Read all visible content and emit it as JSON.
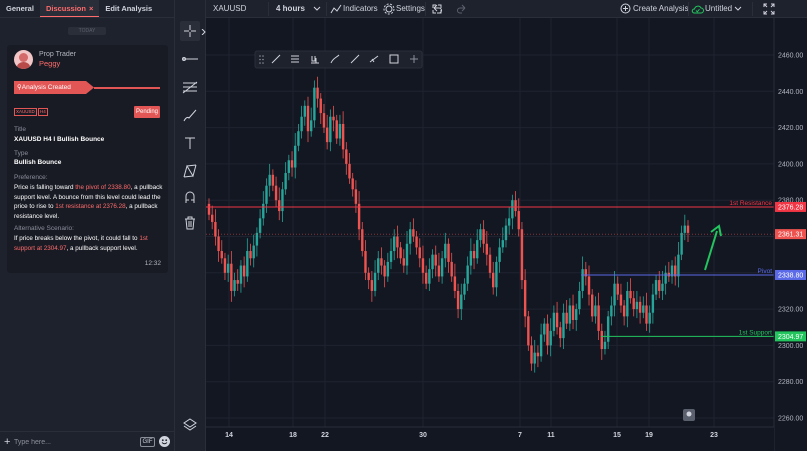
{
  "tabs": {
    "general": "General",
    "discussion": "Discussion",
    "close": "×",
    "edit": "Edit Analysis"
  },
  "day_divider": "TODAY",
  "post": {
    "role": "Prop Trader",
    "user": "Peggy",
    "created": "Analysis Created",
    "tag_symbol": "XAUUSD",
    "tag_tf": "H4",
    "status": "Pending",
    "title_label": "Title",
    "title": "XAUUSD H4 I Bullish Bounce",
    "type_label": "Type",
    "type": "Bullish Bounce",
    "pref_label": "Preference:",
    "pref_1": "Price is falling toward ",
    "pref_2": "the pivot of 2338.80",
    "pref_3": ", a pullback support level. A bounce from this level could lead the price to rise to ",
    "pref_4": "1st resistance at 2376.28",
    "pref_5": ", a pullback resistance level.",
    "alt_label": "Alternative Scenario:",
    "alt_1": "If price breaks below the pivot, it could fall to ",
    "alt_2": "1st support at 2304.97",
    "alt_3": ", a pullback support level.",
    "time": "12:32"
  },
  "message": {
    "placeholder": "Type here...",
    "gif": "GIF"
  },
  "toolbar": {
    "symbol": "XAUUSD",
    "timeframe": "4 hours",
    "indicators": "Indicators",
    "settings": "Settings",
    "create": "Create Analysis",
    "untitled": "Untitled"
  },
  "colors": {
    "up": "#26a69a",
    "down": "#ef5350",
    "resistance": "#f23645",
    "pivot": "#5b6ae8",
    "support": "#22c55e"
  },
  "levels": {
    "resistance": {
      "label": "1st Resistance",
      "value": "2376.28"
    },
    "pivot": {
      "label": "Pivot",
      "value": "2338.80"
    },
    "support": {
      "label": "1st Support",
      "value": "2304.97"
    },
    "last_price": "2361.31"
  },
  "chart_data": {
    "type": "candlestick",
    "symbol": "XAUUSD",
    "timeframe": "4 hours",
    "y_ticks": [
      2460,
      2440,
      2420,
      2400,
      2380,
      2360,
      2340,
      2320,
      2300,
      2280,
      2260
    ],
    "ylim": [
      2255,
      2470
    ],
    "x_ticks": [
      "14",
      "18",
      "22",
      "30",
      "7",
      "11",
      "15",
      "19",
      "23"
    ],
    "closes": [
      2372,
      2368,
      2360,
      2352,
      2348,
      2340,
      2345,
      2330,
      2336,
      2334,
      2344,
      2338,
      2352,
      2348,
      2355,
      2362,
      2370,
      2378,
      2388,
      2394,
      2388,
      2380,
      2374,
      2386,
      2395,
      2402,
      2398,
      2410,
      2418,
      2426,
      2432,
      2418,
      2424,
      2442,
      2436,
      2428,
      2420,
      2412,
      2426,
      2424,
      2414,
      2422,
      2408,
      2400,
      2392,
      2386,
      2378,
      2364,
      2352,
      2340,
      2336,
      2330,
      2340,
      2348,
      2344,
      2338,
      2346,
      2352,
      2360,
      2354,
      2348,
      2344,
      2356,
      2364,
      2360,
      2354,
      2348,
      2340,
      2334,
      2342,
      2350,
      2344,
      2338,
      2348,
      2356,
      2346,
      2338,
      2330,
      2320,
      2328,
      2334,
      2344,
      2352,
      2348,
      2358,
      2364,
      2356,
      2350,
      2340,
      2332,
      2346,
      2354,
      2358,
      2366,
      2370,
      2380,
      2374,
      2364,
      2336,
      2316,
      2300,
      2290,
      2296,
      2294,
      2306,
      2312,
      2300,
      2308,
      2318,
      2310,
      2304,
      2318,
      2312,
      2322,
      2314,
      2320,
      2330,
      2342,
      2338,
      2328,
      2316,
      2322,
      2308,
      2298,
      2302,
      2316,
      2322,
      2334,
      2328,
      2322,
      2316,
      2330,
      2326,
      2320,
      2324,
      2318,
      2322,
      2312,
      2318,
      2328,
      2336,
      2330,
      2334,
      2340,
      2338,
      2344,
      2338,
      2350,
      2362,
      2366,
      2362
    ]
  }
}
